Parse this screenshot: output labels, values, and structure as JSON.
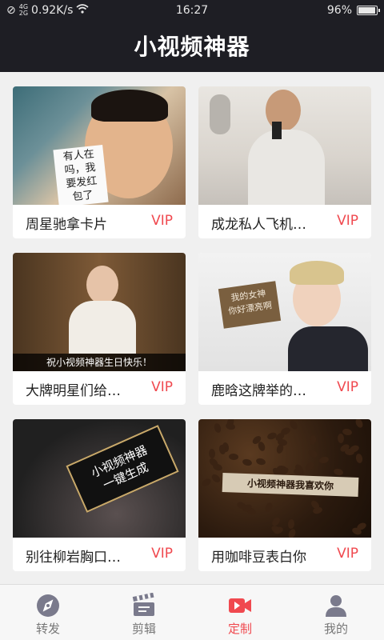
{
  "status": {
    "network_speed": "0.92K/s",
    "signal_labels": [
      "4G",
      "2G"
    ],
    "time": "16:27",
    "battery": "96%",
    "battery_fraction": 0.96
  },
  "header": {
    "title": "小视频神器"
  },
  "cards": [
    {
      "title": "周星驰拿卡片",
      "badge": "VIP",
      "thumb_text": "有人在\n吗，我\n要发红\n包了"
    },
    {
      "title": "成龙私人飞机…",
      "badge": "VIP"
    },
    {
      "title": "大牌明星们给…",
      "badge": "VIP",
      "thumb_text": "祝小视频神器生日快乐！"
    },
    {
      "title": "鹿晗这牌举的…",
      "badge": "VIP",
      "thumb_text": "我的女神\n你好漂亮啊"
    },
    {
      "title": "别往柳岩胸口…",
      "badge": "VIP",
      "thumb_text": "小视频神器\n一键生成"
    },
    {
      "title": "用咖啡豆表白你",
      "badge": "VIP",
      "thumb_text": "小视频神器我喜欢你"
    }
  ],
  "tabs": [
    {
      "label": "转发",
      "icon": "compass-icon",
      "active": false
    },
    {
      "label": "剪辑",
      "icon": "clapperboard-icon",
      "active": false
    },
    {
      "label": "定制",
      "icon": "video-camera-icon",
      "active": true
    },
    {
      "label": "我的",
      "icon": "person-icon",
      "active": false
    }
  ],
  "colors": {
    "header_bg": "#1e1e24",
    "accent": "#f0494f",
    "page_bg": "#f0f0f0",
    "tab_inactive": "#777777"
  }
}
